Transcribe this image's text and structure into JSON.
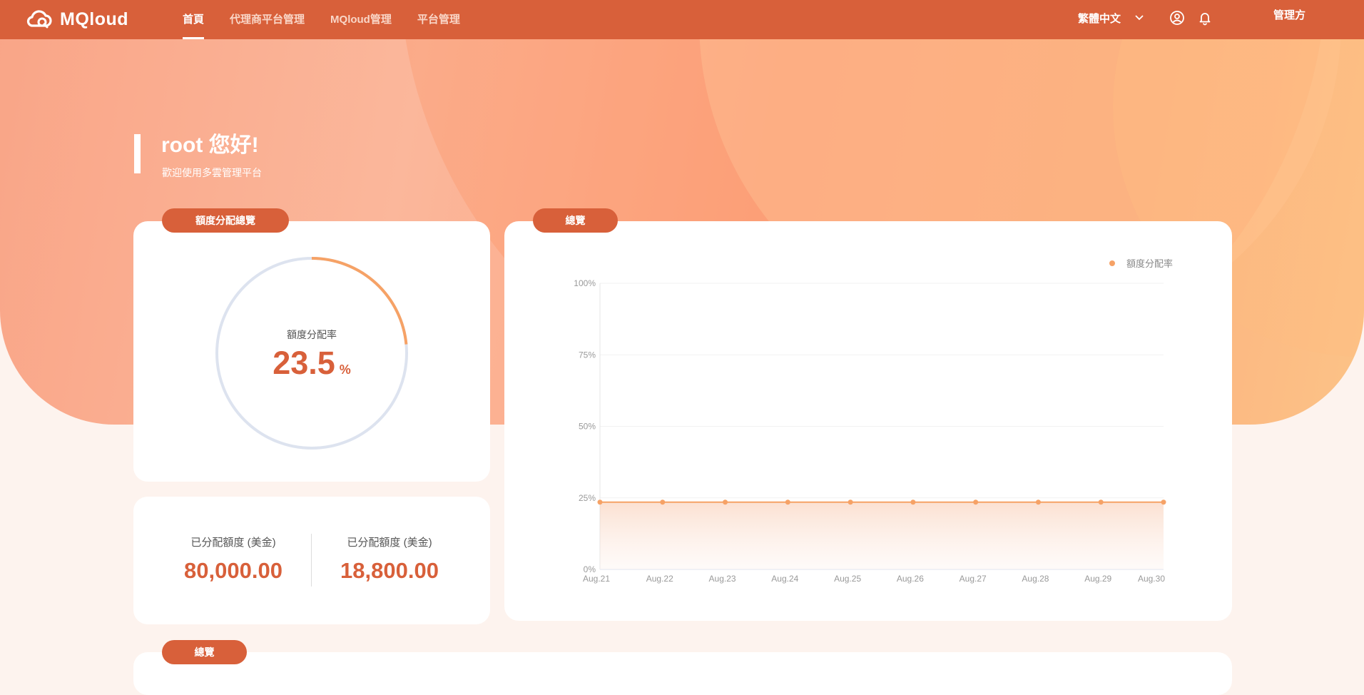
{
  "brand": {
    "name": "MQloud"
  },
  "nav": {
    "items": [
      {
        "label": "首頁",
        "active": true
      },
      {
        "label": "代理商平台管理",
        "active": false
      },
      {
        "label": "MQloud管理",
        "active": false
      },
      {
        "label": "平台管理",
        "active": false
      }
    ]
  },
  "header": {
    "language": "繁體中文",
    "role": "管理方",
    "icons": [
      "user-circle-icon",
      "bell-icon",
      "chevron-down-icon"
    ]
  },
  "welcome": {
    "title": "root 您好!",
    "subtitle": "歡迎使用多雲管理平台"
  },
  "quota_card": {
    "tag": "額度分配總覽",
    "ring_label": "額度分配率",
    "ring_value": "23.5",
    "ring_unit": "%",
    "ring_fraction": 0.235
  },
  "amounts": {
    "left_label": "已分配額度 (美金)",
    "left_value": "80,000.00",
    "right_label": "已分配額度 (美金)",
    "right_value": "18,800.00"
  },
  "overview_card": {
    "tag": "總覽"
  },
  "bottom_card": {
    "tag": "總覽"
  },
  "colors": {
    "brand": "#d8603a",
    "accent": "#f6a266",
    "ring_track": "#dde3ef"
  },
  "chart_data": {
    "type": "line",
    "x": [
      "Aug.21",
      "Aug.22",
      "Aug.23",
      "Aug.24",
      "Aug.25",
      "Aug.26",
      "Aug.27",
      "Aug.28",
      "Aug.29",
      "Aug.30"
    ],
    "series": [
      {
        "name": "額度分配率",
        "values": [
          23.5,
          23.5,
          23.5,
          23.5,
          23.5,
          23.5,
          23.5,
          23.5,
          23.5,
          23.5
        ]
      }
    ],
    "yticks": [
      "0%",
      "25%",
      "50%",
      "75%",
      "100%"
    ],
    "ylim": [
      0,
      100
    ],
    "legend_position": "top-right",
    "grid": true
  }
}
